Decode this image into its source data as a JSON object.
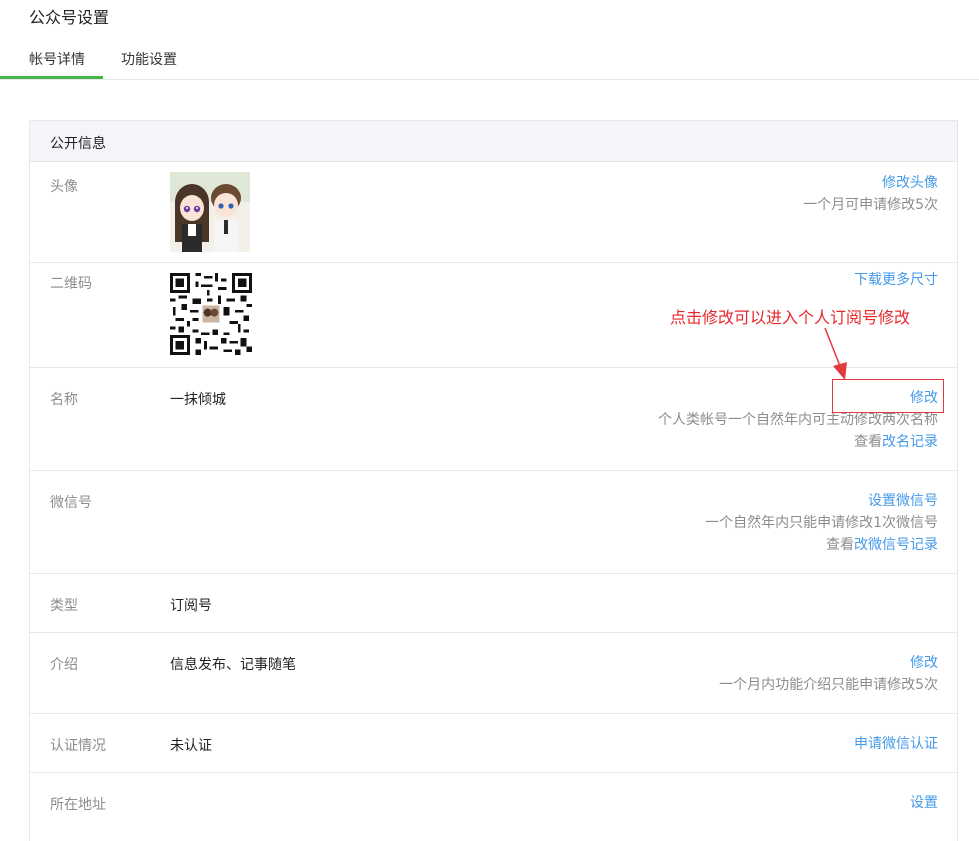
{
  "page": {
    "title": "公众号设置"
  },
  "tabs": [
    {
      "label": "帐号详情"
    },
    {
      "label": "功能设置"
    }
  ],
  "panel": {
    "title": "公开信息"
  },
  "rows": {
    "avatar": {
      "label": "头像",
      "action": "修改头像",
      "tip": "一个月可申请修改5次"
    },
    "qrcode": {
      "label": "二维码",
      "action": "下载更多尺寸"
    },
    "name": {
      "label": "名称",
      "value": "一抹倾城",
      "action": "修改",
      "tip": "个人类帐号一个自然年内可主动修改两次名称",
      "record_prefix": "查看",
      "record_link": "改名记录"
    },
    "wechat_id": {
      "label": "微信号",
      "action": "设置微信号",
      "tip": "一个自然年内只能申请修改1次微信号",
      "record_prefix": "查看",
      "record_link": "改微信号记录"
    },
    "type": {
      "label": "类型",
      "value": "订阅号"
    },
    "intro": {
      "label": "介绍",
      "value": "信息发布、记事随笔",
      "action": "修改",
      "tip": "一个月内功能介绍只能申请修改5次"
    },
    "verify": {
      "label": "认证情况",
      "value": "未认证",
      "action": "申请微信认证"
    },
    "address": {
      "label": "所在地址",
      "action": "设置"
    }
  },
  "annotation": {
    "text": "点击修改可以进入个人订阅号修改"
  },
  "colors": {
    "accent_green": "#44b549",
    "link_blue": "#459ae9",
    "annotation_red": "#e9282c"
  }
}
